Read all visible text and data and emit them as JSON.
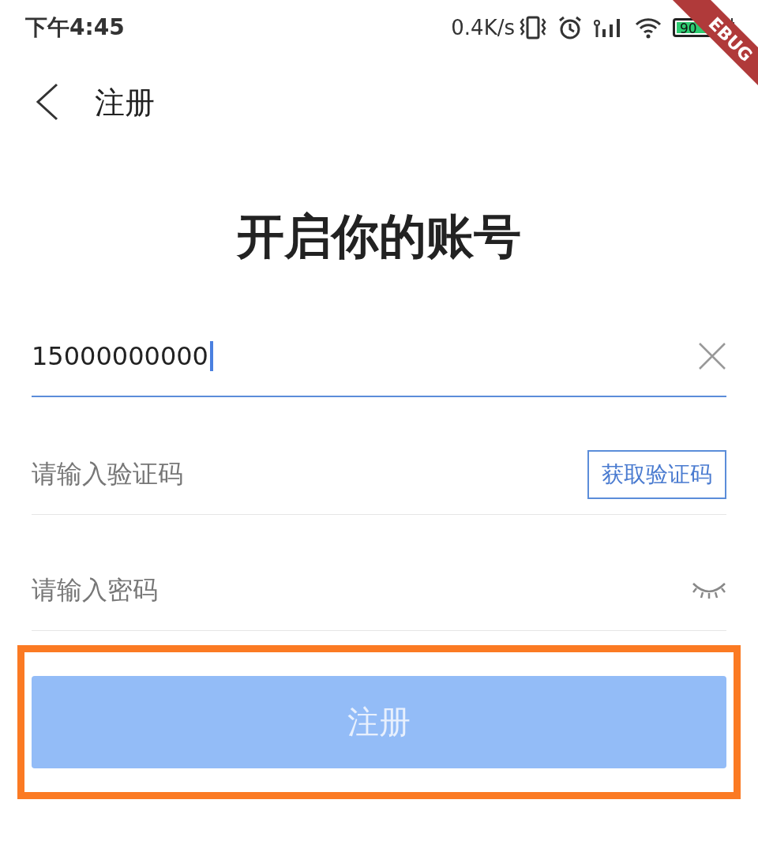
{
  "status_bar": {
    "time": "下午4:45",
    "net_speed": "0.4K/s",
    "battery": "90"
  },
  "debug_banner": "EBUG",
  "app_bar": {
    "title": "注册"
  },
  "heading": "开启你的账号",
  "phone_field": {
    "value": "15000000000",
    "focused": true
  },
  "code_field": {
    "placeholder": "请输入验证码",
    "button": "获取验证码"
  },
  "password_field": {
    "placeholder": "请输入密码"
  },
  "submit": {
    "label": "注册",
    "disabled": true,
    "highlighted": true
  }
}
